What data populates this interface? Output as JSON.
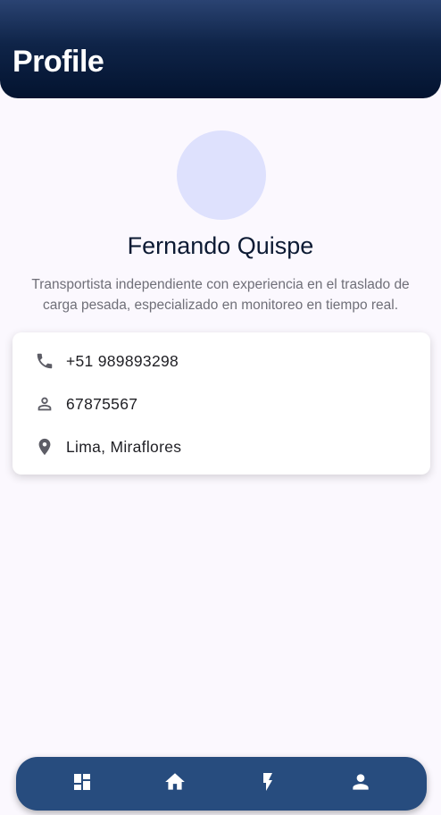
{
  "header": {
    "title": "Profile"
  },
  "profile": {
    "name": "Fernando Quispe",
    "bio": "Transportista independiente con experiencia en el traslado de carga pesada, especializado en monitoreo en tiempo real."
  },
  "info_card": {
    "items": [
      {
        "icon": "phone-icon",
        "text": "+51 989893298"
      },
      {
        "icon": "person-icon",
        "text": "67875567"
      },
      {
        "icon": "location-pin-icon",
        "text": "Lima, Miraflores"
      }
    ]
  },
  "bottom_nav": {
    "items": [
      {
        "icon": "dashboard-icon"
      },
      {
        "icon": "home-icon"
      },
      {
        "icon": "bolt-icon"
      },
      {
        "icon": "profile-icon"
      }
    ]
  },
  "colors": {
    "header_dark": "#03132f",
    "nav_bg": "#274c7e",
    "avatar_bg": "#dee1fd",
    "page_bg": "#fbf8fe"
  }
}
